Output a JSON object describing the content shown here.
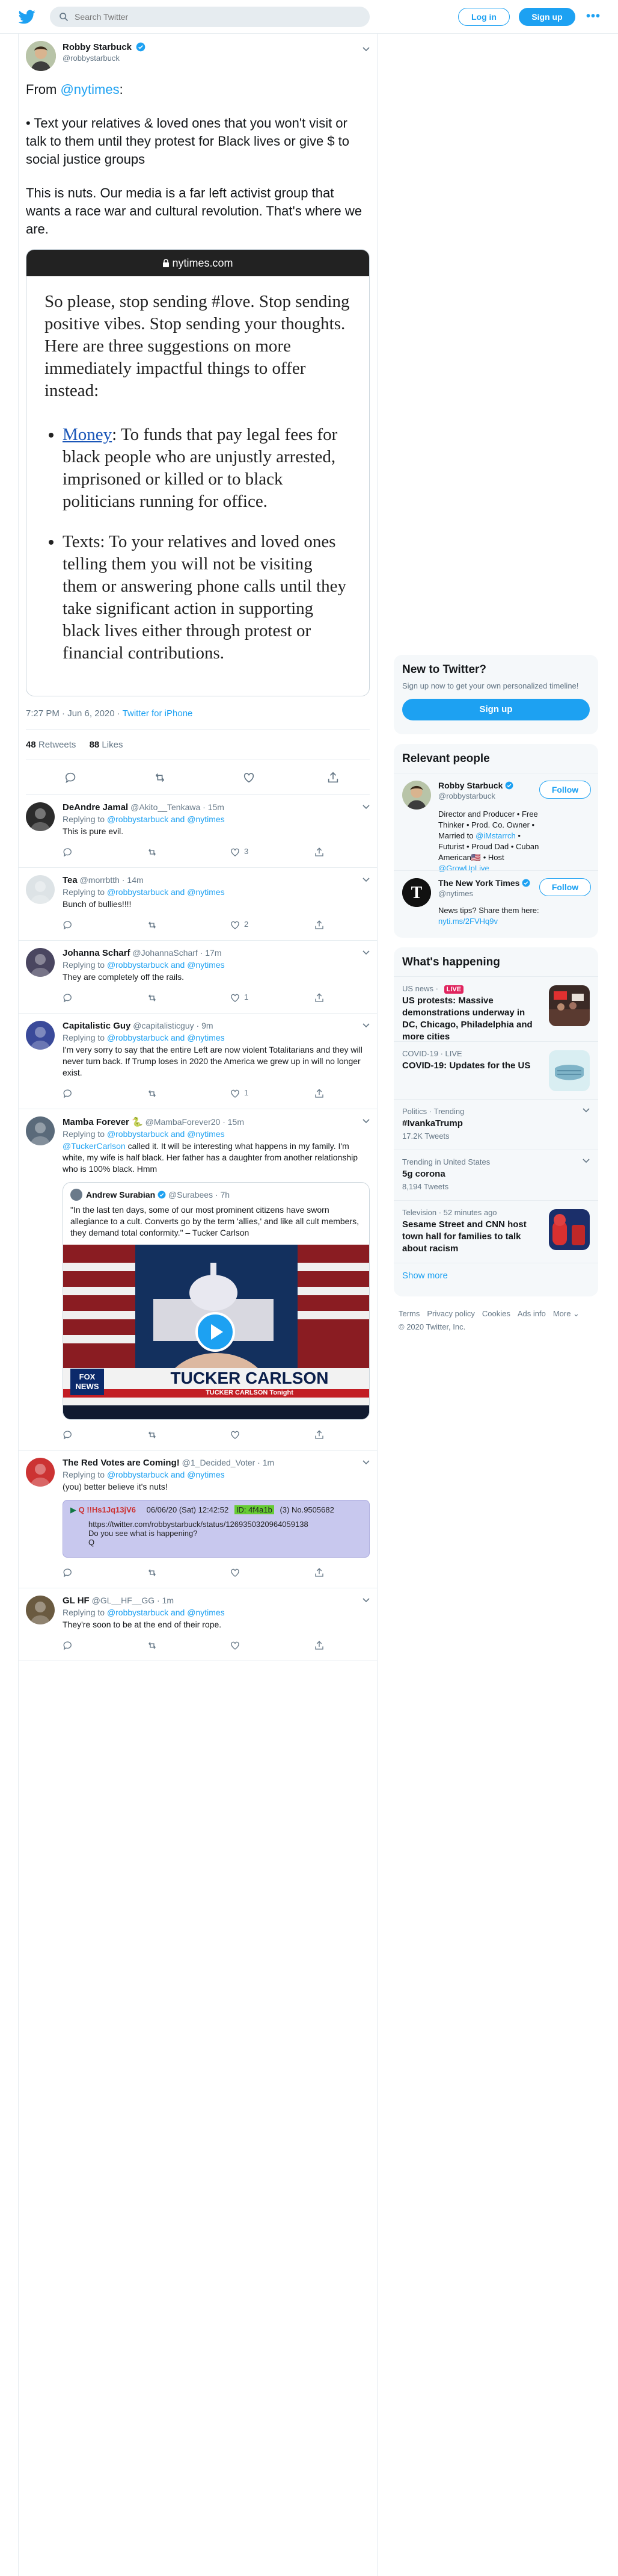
{
  "header": {
    "search_placeholder": "Search Twitter",
    "login_label": "Log in",
    "signup_label": "Sign up",
    "more_label": "•••"
  },
  "tweet": {
    "author_name": "Robby Starbuck",
    "author_handle": "@robbystarbuck",
    "text_from": "From ",
    "text_from_link": "@nytimes",
    "text_from_end": ":",
    "text_p2": "• Text your relatives & loved ones that you won't visit or talk to them until they protest for Black lives or give $ to social justice groups",
    "text_p3": "This is nuts. Our media is a far left activist group that wants a race war and cultural revolution. That's where we are.",
    "card": {
      "domain": "nytimes.com",
      "intro": "So please, stop sending #love. Stop sending positive vibes. Stop sending your thoughts. Here are three suggestions on more immediately impactful things to offer instead:",
      "bullet1_link": "Money",
      "bullet1_text": ": To funds that pay legal fees for black people who are unjustly arrested, imprisoned or killed or to black politicians running for office.",
      "bullet2_text": "Texts: To your relatives and loved ones telling them you will not be visiting them or answering phone calls until they take significant action in supporting black lives either through protest or financial contributions."
    },
    "time": "7:27 PM · Jun 6, 2020",
    "via": "Twitter for iPhone",
    "retweets": "48",
    "retweets_label": "Retweets",
    "likes": "88",
    "likes_label": "Likes"
  },
  "replies": [
    {
      "name": "DeAndre Jamal",
      "handle": "@Akito__Tenkawa · 15m",
      "replying": "Replying to",
      "to": "@robbystarbuck and @nytimes",
      "text": "This is pure evil.",
      "likes": "3",
      "avatar_color": "#2b2b2b"
    },
    {
      "name": "Tea",
      "handle": "@morrbtth · 14m",
      "replying": "Replying to",
      "to": "@robbystarbuck and @nytimes",
      "text": "Bunch of bullies!!!!",
      "likes": "2",
      "avatar_color": "#dde3e6"
    },
    {
      "name": "Johanna Scharf",
      "handle": "@JohannaScharf · 17m",
      "replying": "Replying to",
      "to": "@robbystarbuck and @nytimes",
      "text": "They are completely off the rails.",
      "likes": "1",
      "avatar_color": "#4a4660"
    },
    {
      "name": "Capitalistic Guy",
      "handle": "@capitalisticguy · 9m",
      "replying": "Replying to",
      "to": "@robbystarbuck and @nytimes",
      "text": "I'm very sorry  to say that the entire Left are now violent Totalitarians and they will never turn back. If Trump loses in 2020 the America we grew up in will no longer exist.",
      "likes": "1",
      "avatar_color": "#3a4a9a"
    },
    {
      "name": "Mamba Forever 🐍",
      "handle": "@MambaForever20 · 15m",
      "replying": "Replying to",
      "to": "@robbystarbuck and @nytimes",
      "text_link": "@TuckerCarlson",
      "text": " called it. It will be interesting what happens in my family. I'm white, my wife is half black. Her father has a daughter from another relationship who is 100% black. Hmm",
      "quote_name": "Andrew Surabian",
      "quote_handle": "@Surabees · 7h",
      "quote_text": "\"In the last ten days, some of our most prominent citizens have sworn allegiance to a cult. Converts go by the term 'allies,' and like all cult members, they demand total conformity.\" – Tucker Carlson",
      "video_lower": "TUCKER CARLSON",
      "video_lower2": "TUCKER CARLSON Tonight",
      "video_brand": "FOX NEWS",
      "avatar_color": "#5a6a7a"
    },
    {
      "name": "The Red Votes are Coming!",
      "handle": "@1_Decided_Voter · 1m",
      "replying": "Replying to",
      "to": "@robbystarbuck and @nytimes",
      "text": "(you) better believe it's nuts!",
      "attach_line1": "06/06/20 (Sat) 12:42:52",
      "attach_id_label": "ID: 4f4a1b",
      "attach_post": "(3)  No.9505682",
      "attach_link": "https://twitter.com/robbystarbuck/status/1269350320964059138",
      "attach_q": "Do you see what is happening?",
      "attach_sig": "Q",
      "attach_trip": "Q !!Hs1Jq13jV6",
      "avatar_color": "#c33"
    },
    {
      "name": "GL HF",
      "handle": "@GL__HF__GG · 1m",
      "replying": "Replying to",
      "to": "@robbystarbuck and @nytimes",
      "text": "They're soon to be at the end of their rope.",
      "avatar_color": "#6a5a40"
    }
  ],
  "sidebar": {
    "new_title": "New to Twitter?",
    "new_sub": "Sign up now to get your own personalized timeline!",
    "new_button": "Sign up",
    "relevant_title": "Relevant people",
    "people": [
      {
        "name": "Robby Starbuck",
        "handle": "@robbystarbuck",
        "follow": "Follow",
        "bio_a": "Director and Producer • Free Thinker • Prod. Co. Owner • Married to ",
        "bio_link1": "@iMstarrch",
        "bio_b": " • Futurist • Proud Dad • Cuban American🇺🇸 • Host ",
        "bio_link2": "@GrowUpLive"
      },
      {
        "name": "The New York Times",
        "handle": "@nytimes",
        "follow": "Follow",
        "bio_a": "News tips? Share them here: ",
        "bio_link1": "nyti.ms/2FVHq9v"
      }
    ],
    "happening_title": "What's happening",
    "trends": [
      {
        "cat": "US news · ",
        "live": "LIVE",
        "title": "US protests: Massive demonstrations underway in DC, Chicago, Philadelphia and more cities"
      },
      {
        "cat": "COVID-19 · LIVE",
        "title": "COVID-19: Updates for the US"
      },
      {
        "cat": "Politics · Trending",
        "title": "#IvankaTrump",
        "sub": "17.2K Tweets"
      },
      {
        "cat": "Trending in United States",
        "title": "5g corona",
        "sub": "8,194 Tweets"
      },
      {
        "cat": "Television · 52 minutes ago",
        "title": "Sesame Street and CNN host town hall for families to talk about racism"
      }
    ],
    "show_more": "Show more",
    "footer_links": [
      "Terms",
      "Privacy policy",
      "Cookies",
      "Ads info",
      "More ⌄"
    ],
    "copyright": "© 2020 Twitter, Inc."
  },
  "colors": {
    "brand": "#1da1f2",
    "live": "#e0245e"
  }
}
